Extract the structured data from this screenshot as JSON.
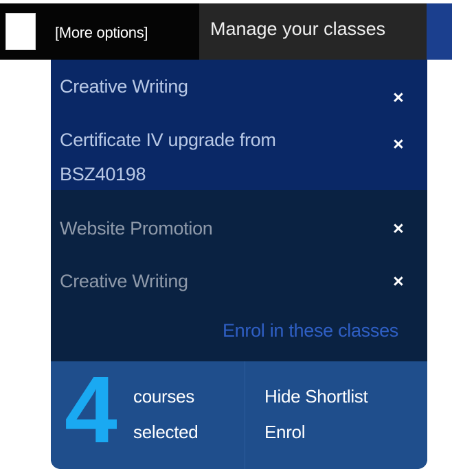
{
  "topbar": {
    "more_options_label": "[More options]",
    "manage_tab_label": "Manage your classes"
  },
  "shortlist": {
    "items": [
      {
        "label": "Creative Writing",
        "remove_icon": "×",
        "state": "active"
      },
      {
        "label": "Certificate IV upgrade from BSZ40198",
        "remove_icon": "×",
        "state": "active"
      },
      {
        "label": "Website Promotion",
        "remove_icon": "×",
        "state": "inactive"
      },
      {
        "label": "Creative Writing",
        "remove_icon": "×",
        "state": "inactive"
      }
    ],
    "enrol_link_label": "Enrol in these classes"
  },
  "footer": {
    "count": "4",
    "count_word_1": "courses",
    "count_word_2": "selected",
    "hide_shortlist_label": "Hide Shortlist",
    "enrol_label": "Enrol"
  },
  "colors": {
    "panel_bg": "#0b2a55",
    "footer_bg": "#1f4e8c",
    "count_color": "#1aa9f2",
    "link_color": "#2f5fc4"
  }
}
